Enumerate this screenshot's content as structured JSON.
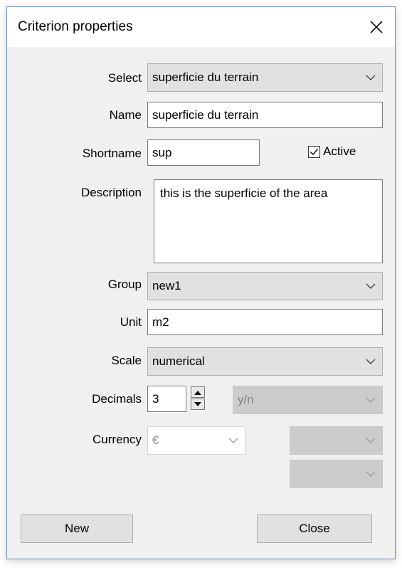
{
  "window": {
    "title": "Criterion properties"
  },
  "form": {
    "select_label": "Select",
    "select_value": "superficie du terrain",
    "name_label": "Name",
    "name_value": "superficie du terrain",
    "shortname_label": "Shortname",
    "shortname_value": "sup",
    "active_label": "Active",
    "active_checked": true,
    "description_label": "Description",
    "description_value": "this is the superficie of the area",
    "group_label": "Group",
    "group_value": "new1",
    "unit_label": "Unit",
    "unit_value": "m2",
    "scale_label": "Scale",
    "scale_value": "numerical",
    "decimals_label": "Decimals",
    "decimals_value": "3",
    "yn_value": "y/n",
    "currency_label": "Currency",
    "currency_value": "€",
    "currency_extra1_value": "",
    "currency_extra2_value": ""
  },
  "buttons": {
    "new_label": "New",
    "close_label": "Close"
  },
  "icons": {
    "close": "close-icon",
    "chevron": "chevron-down-icon",
    "check": "checkmark-icon",
    "spin_up": "arrow-up-icon",
    "spin_down": "arrow-down-icon"
  },
  "colors": {
    "dialog_bg": "#f0f0f0",
    "titlebar_bg": "#ffffff",
    "border_accent": "#6a8fb8",
    "button_bg": "#e1e1e1"
  }
}
